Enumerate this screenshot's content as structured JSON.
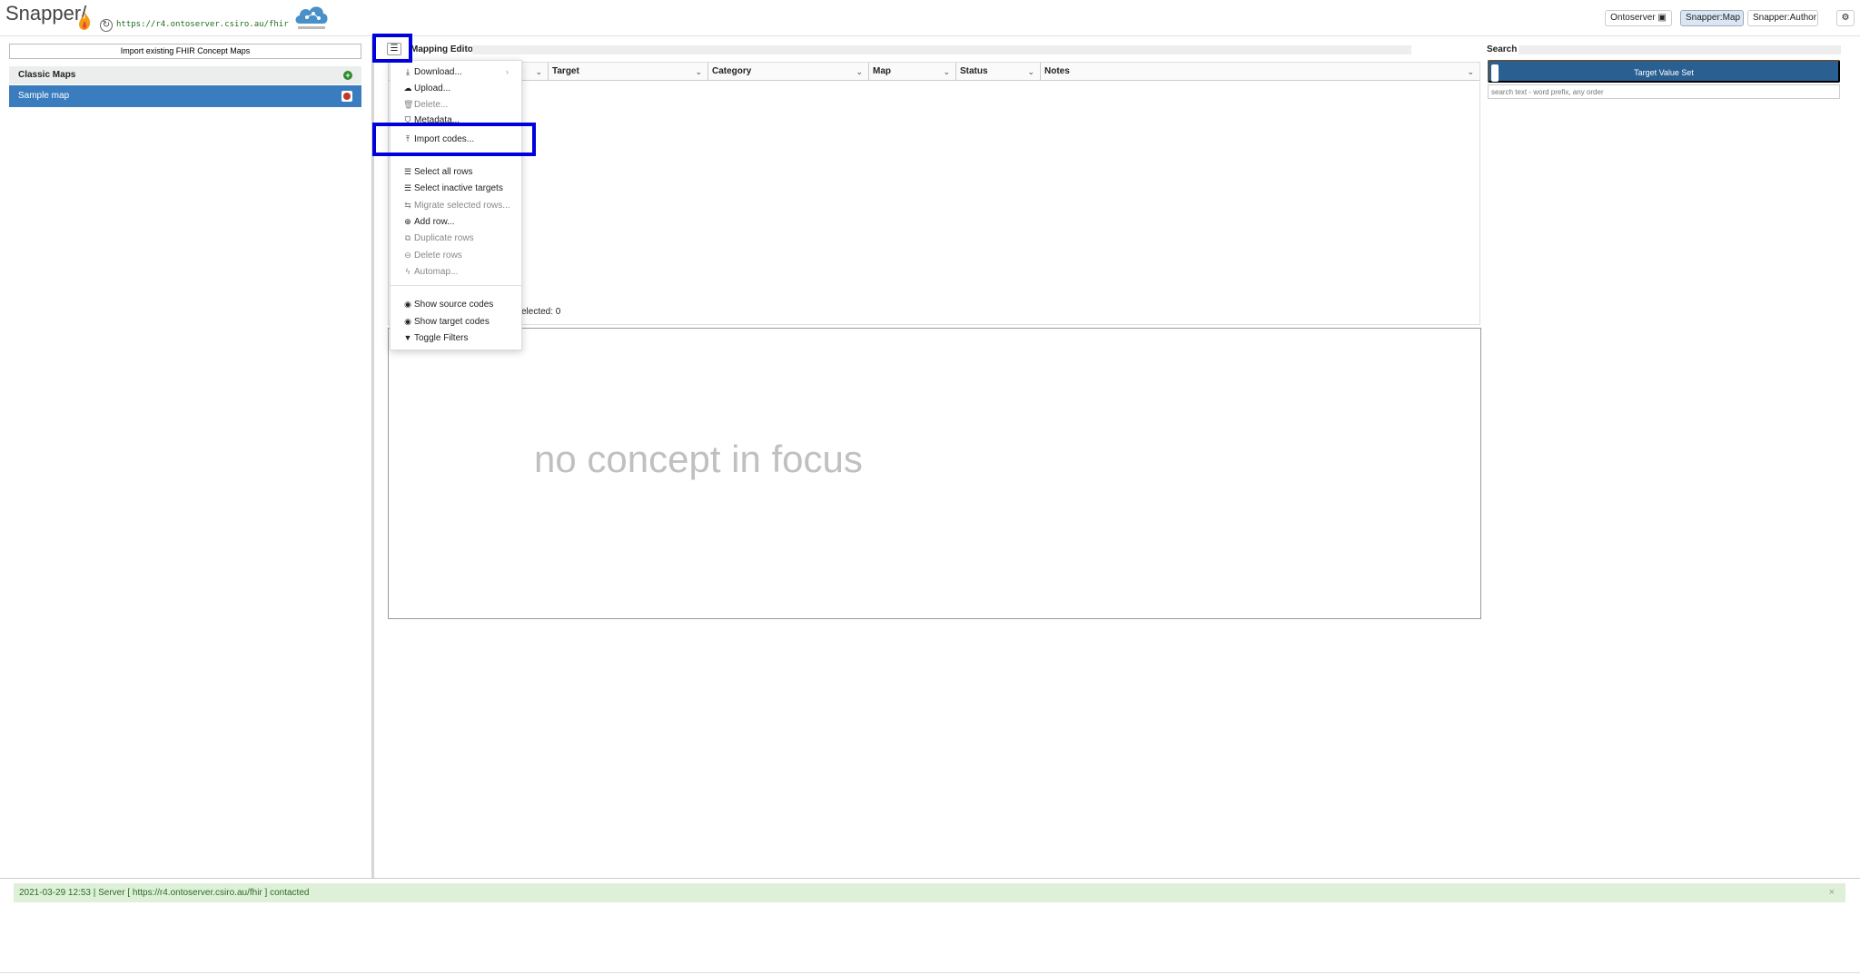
{
  "header": {
    "app_title": "Snapper/",
    "server_url": "https://r4.ontoserver.csiro.au/fhir",
    "buttons": {
      "ontoserver": "Ontoserver",
      "snapper_map": "Snapper:Map",
      "snapper_author": "Snapper:Author"
    },
    "active_button": "Snapper:Map"
  },
  "left": {
    "import_button": "Import existing FHIR Concept Maps",
    "section_title": "Classic Maps",
    "maps": [
      {
        "label": "Sample map",
        "selected": true
      }
    ]
  },
  "editor": {
    "title": "Mapping Editor",
    "columns": [
      "Target",
      "Category",
      "Map",
      "Status",
      "Notes"
    ],
    "selected_text": "elected: 0",
    "focus_placeholder": "no concept in focus"
  },
  "menu": {
    "items": [
      {
        "label": "Download...",
        "icon": "download-icon",
        "disabled": false,
        "submenu": true
      },
      {
        "label": "Upload...",
        "icon": "upload-icon",
        "disabled": false
      },
      {
        "label": "Delete...",
        "icon": "trash-icon",
        "disabled": true
      },
      {
        "label": "Metadata...",
        "icon": "tag-icon",
        "disabled": false
      },
      {
        "label": "Import codes...",
        "icon": "import-icon",
        "disabled": false,
        "highlighted": true
      },
      {
        "label": "Select all rows",
        "icon": "list-icon",
        "disabled": false
      },
      {
        "label": "Select inactive targets",
        "icon": "list-icon",
        "disabled": false
      },
      {
        "label": "Migrate selected rows...",
        "icon": "migrate-icon",
        "disabled": true
      },
      {
        "label": "Add row...",
        "icon": "plus-circle-icon",
        "disabled": false
      },
      {
        "label": "Duplicate rows",
        "icon": "duplicate-icon",
        "disabled": true
      },
      {
        "label": "Delete rows",
        "icon": "minus-circle-icon",
        "disabled": true
      },
      {
        "label": "Automap...",
        "icon": "bolt-icon",
        "disabled": true
      },
      {
        "label": "Show source codes",
        "icon": "eye-icon",
        "disabled": false
      },
      {
        "label": "Show target codes",
        "icon": "eye-icon",
        "disabled": false
      },
      {
        "label": "Toggle Filters",
        "icon": "filter-icon",
        "disabled": false
      }
    ]
  },
  "search": {
    "title": "Search",
    "value_set_button": "Target Value Set",
    "placeholder": "search text - word prefix, any order"
  },
  "status": {
    "message": "2021-03-29 12:53 | Server [ https://r4.ontoserver.csiro.au/fhir ] contacted",
    "close": "×"
  },
  "colors": {
    "selected_row": "#3a7dbf",
    "value_set_button": "#2a5f92",
    "highlight_box": "#0000dd",
    "status_bg": "#dff0d8"
  }
}
